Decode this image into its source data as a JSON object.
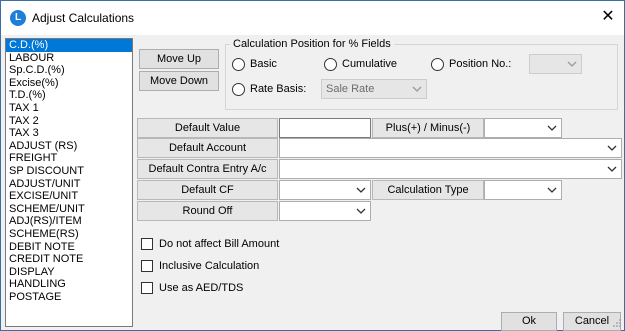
{
  "window": {
    "title": "Adjust Calculations",
    "icon_glyph": "L"
  },
  "list": {
    "items": [
      "C.D.(%)",
      "LABOUR",
      "Sp.C.D.(%)",
      "Excise(%)",
      "T.D.(%)",
      "TAX 1",
      "TAX 2",
      "TAX 3",
      "ADJUST (RS)",
      "FREIGHT",
      "SP DISCOUNT",
      "ADJUST/UNIT",
      "EXCISE/UNIT",
      "SCHEME/UNIT",
      "ADJ(RS)/ITEM",
      "SCHEME(RS)",
      "DEBIT NOTE",
      "CREDIT NOTE",
      "DISPLAY",
      "HANDLING",
      "POSTAGE"
    ],
    "selected_index": 0
  },
  "buttons": {
    "move_up": "Move Up",
    "move_down": "Move Down",
    "ok": "Ok",
    "cancel": "Cancel"
  },
  "position_group": {
    "title": "Calculation Position for % Fields",
    "basic": "Basic",
    "cumulative": "Cumulative",
    "position_no": "Position No.:",
    "rate_basis": "Rate Basis:",
    "rate_basis_value": "Sale Rate",
    "position_no_value": ""
  },
  "fields": {
    "default_value": "Default Value",
    "default_value_input": "",
    "plus_minus": "Plus(+) / Minus(-)",
    "plus_minus_value": "",
    "default_account": "Default Account",
    "default_account_value": "",
    "default_contra": "Default Contra Entry A/c",
    "default_contra_value": "",
    "default_cf": "Default CF",
    "default_cf_value": "",
    "calculation_type": "Calculation Type",
    "calculation_type_value": "",
    "round_off": "Round Off",
    "round_off_value": ""
  },
  "checkboxes": {
    "no_affect_bill": "Do not affect Bill Amount",
    "inclusive_calc": "Inclusive Calculation",
    "use_as_aed": "Use as AED/TDS"
  },
  "colors": {
    "selection": "#0078d7",
    "window_bg": "#f0f0f0",
    "app_icon": "#1e7ed8"
  }
}
